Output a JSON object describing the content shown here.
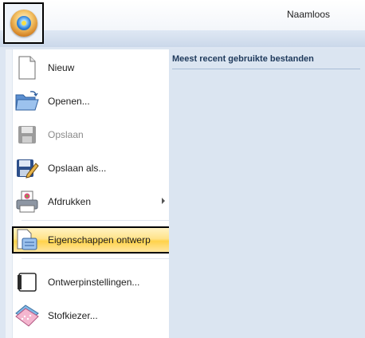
{
  "window": {
    "title": "Naamloos"
  },
  "app_button": {
    "icon": "application-orb-icon"
  },
  "menu": {
    "items": [
      {
        "label": "Nieuw",
        "icon": "new-document-icon",
        "enabled": true,
        "submenu": false
      },
      {
        "label": "Openen...",
        "icon": "open-folder-icon",
        "enabled": true,
        "submenu": false
      },
      {
        "label": "Opslaan",
        "icon": "save-disk-icon",
        "enabled": false,
        "submenu": false
      },
      {
        "label": "Opslaan als...",
        "icon": "save-as-icon",
        "enabled": true,
        "submenu": false
      },
      {
        "label": "Afdrukken",
        "icon": "printer-icon",
        "enabled": true,
        "submenu": true
      },
      {
        "label": "Eigenschappen ontwerp",
        "icon": "design-properties-icon",
        "enabled": true,
        "submenu": false,
        "highlighted": true
      },
      {
        "label": "Ontwerpinstellingen...",
        "icon": "design-settings-icon",
        "enabled": true,
        "submenu": false
      },
      {
        "label": "Stofkiezer...",
        "icon": "fabric-selector-icon",
        "enabled": true,
        "submenu": false
      }
    ]
  },
  "recent": {
    "header": "Meest recent gebruikte bestanden"
  },
  "colors": {
    "highlight": "#ffd24a",
    "panel": "#dbe5f1",
    "accent": "#1e395b"
  }
}
